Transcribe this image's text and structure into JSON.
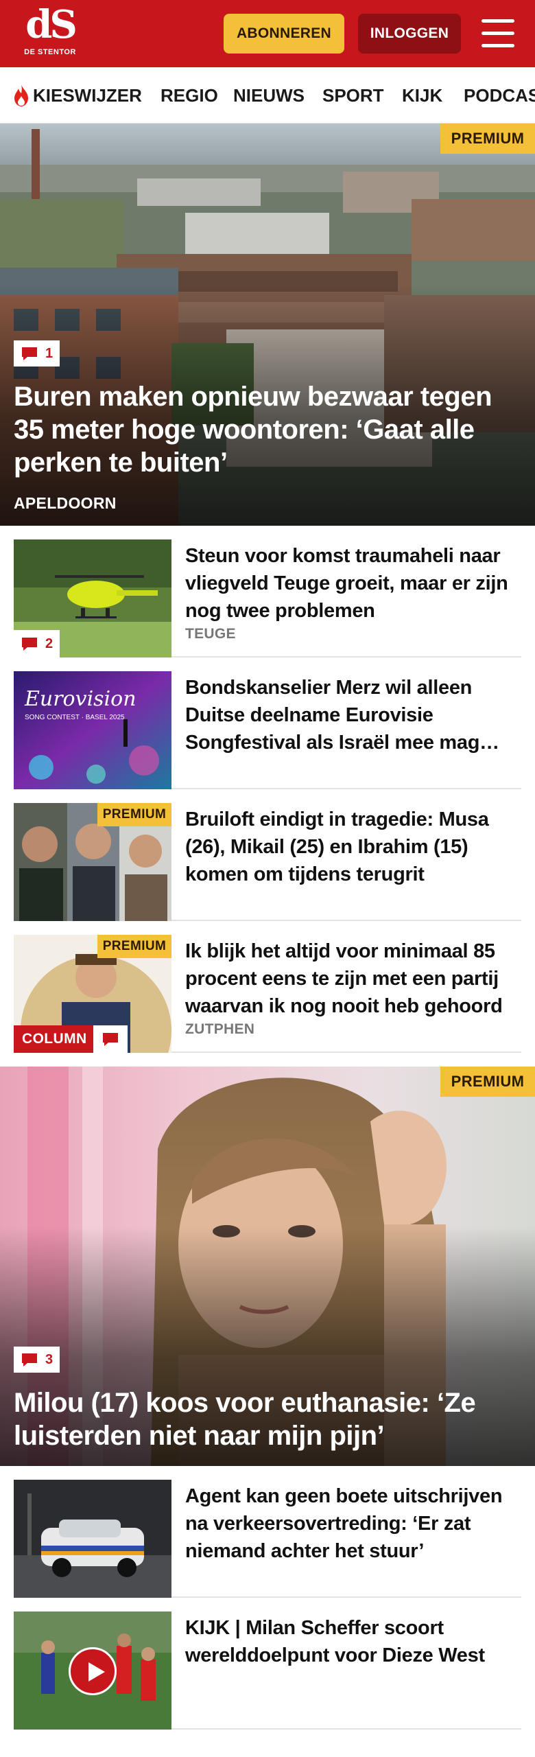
{
  "header": {
    "logo_mark": "dS",
    "logo_name": "DE STENTOR",
    "subscribe_label": "ABONNEREN",
    "login_label": "INLOGGEN",
    "menu_icon": "hamburger-icon",
    "brand_color": "#c8161d",
    "accent_color": "#f4c038"
  },
  "nav": {
    "items": [
      {
        "label": "KIESWIJZER",
        "icon": "flame-icon"
      },
      {
        "label": "REGIO"
      },
      {
        "label": "NIEUWS"
      },
      {
        "label": "SPORT"
      },
      {
        "label": "KIJK"
      },
      {
        "label": "PODCAST"
      }
    ]
  },
  "hero1": {
    "badge": "PREMIUM",
    "comments": "1",
    "title": "Buren maken opnieuw bezwaar tegen 35 meter hoge woontoren: ‘Gaat alle perken te buiten’",
    "location": "APELDOORN"
  },
  "articles": [
    {
      "title": "Steun voor komst traumaheli naar vliegveld Teuge groeit, maar er zijn nog twee problemen",
      "location": "TEUGE",
      "comments": "2"
    },
    {
      "title": "Bondskanselier Merz wil alleen Duitse deelname Eurovisie Songfestival als Israël mee mag doen",
      "thumb_text": "Eurovision",
      "thumb_subtext": "SONG CONTEST · BASEL 2025"
    },
    {
      "title": "Bruiloft eindigt in tragedie: Musa (26), Mikail (25) en Ibrahim (15) komen om tijdens terugrit",
      "badge": "PREMIUM"
    },
    {
      "title": "Ik blijk het altijd voor minimaal 85 procent eens te zijn met een partij waarvan ik nog nooit heb gehoord",
      "location": "ZUTPHEN",
      "badge": "PREMIUM",
      "tag": "COLUMN"
    }
  ],
  "hero2": {
    "badge": "PREMIUM",
    "comments": "3",
    "title": "Milou (17) koos voor euthanasie: ‘Ze luisterden niet naar mijn pijn’"
  },
  "articles2": [
    {
      "title": "Agent kan geen boete uitschrij­ven na verkeersovertreding: ‘Er zat niemand achter het stuur’"
    },
    {
      "title": "KIJK | Milan Scheffer scoort werelddoelpunt voor Dieze West",
      "icon": "play-icon"
    }
  ]
}
